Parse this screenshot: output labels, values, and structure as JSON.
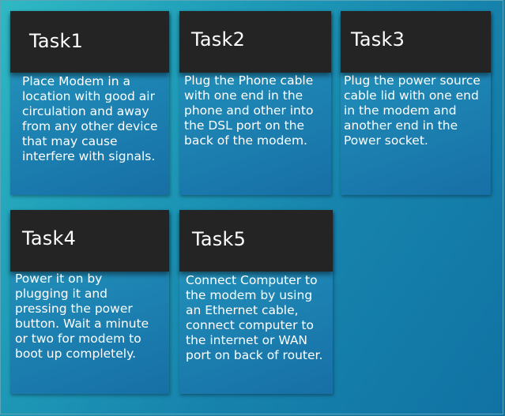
{
  "tasks": [
    {
      "title": "Task1",
      "text": "Place Modem in a\nlocation with good air\ncirculation and away\nfrom any other device\nthat may cause\ninterfere with signals."
    },
    {
      "title": "Task2",
      "text": "Plug the Phone cable\nwith one end in the\nphone and other into\nthe DSL port on the\nback of the modem."
    },
    {
      "title": "Task3",
      "text": "Plug the power source\ncable lid with one end\nin the modem and\nanother end in the\nPower socket."
    },
    {
      "title": "Task4",
      "text": "Power it on by\nplugging it and\npressing the power\nbutton. Wait a minute\nor two for modem to\nboot up completely."
    },
    {
      "title": "Task5",
      "text": "Connect Computer to\nthe modem by using\nan Ethernet cable,\nconnect computer to\nthe internet or WAN\nport on back of router."
    }
  ]
}
